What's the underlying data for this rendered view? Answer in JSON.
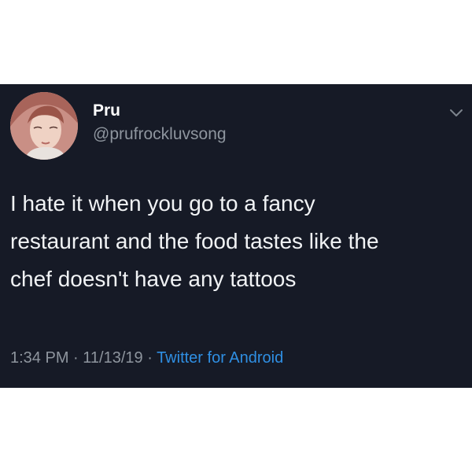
{
  "tweet": {
    "display_name": "Pru",
    "handle": "@prufrockluvsong",
    "text_lines": [
      "I hate it when you go to a fancy",
      "restaurant and the food tastes like the",
      "chef doesn't have any tattoos"
    ],
    "time": "1:34 PM",
    "separator": " · ",
    "date": "11/13/19",
    "client": "Twitter for Android",
    "menu_icon": "chevron-down-icon"
  },
  "colors": {
    "card_background": "#161a26",
    "link": "#2f8fe3",
    "secondary_text": "#8e959e"
  }
}
